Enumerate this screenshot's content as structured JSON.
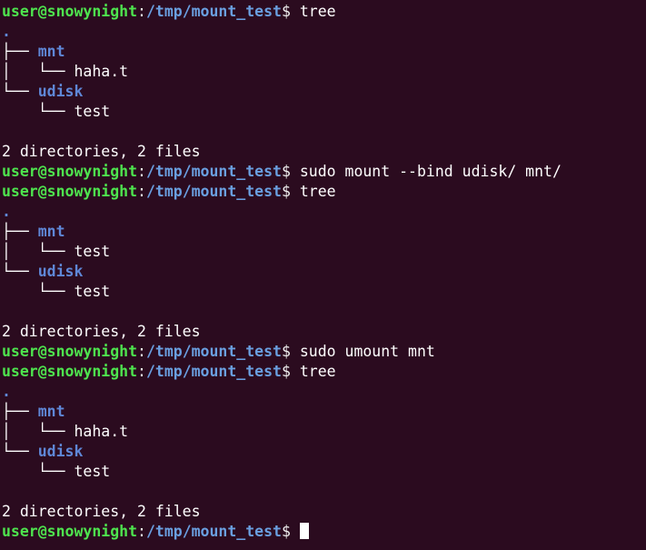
{
  "terminal": {
    "colors": {
      "background": "#2b0b1f",
      "user_green": "#4ee44e",
      "path_blue": "#6a9fe0",
      "dir_blue": "#5f87d7",
      "text_white": "#ffffff"
    },
    "prompt": {
      "user_host": "user@snowynight",
      "separator": ":",
      "path": "/tmp/mount_test",
      "dollar": "$"
    },
    "lines": [
      {
        "type": "prompt",
        "command": "tree"
      },
      {
        "type": "tree_root",
        "text": "."
      },
      {
        "type": "tree_dir",
        "branch": "├── ",
        "name": "mnt"
      },
      {
        "type": "tree_file",
        "branch": "│   └── ",
        "name": "haha.t"
      },
      {
        "type": "tree_dir",
        "branch": "└── ",
        "name": "udisk"
      },
      {
        "type": "tree_file",
        "branch": "    └── ",
        "name": "test"
      },
      {
        "type": "blank"
      },
      {
        "type": "output",
        "text": "2 directories, 2 files"
      },
      {
        "type": "prompt",
        "command": "sudo mount --bind udisk/ mnt/"
      },
      {
        "type": "prompt",
        "command": "tree"
      },
      {
        "type": "tree_root",
        "text": "."
      },
      {
        "type": "tree_dir",
        "branch": "├── ",
        "name": "mnt"
      },
      {
        "type": "tree_file",
        "branch": "│   └── ",
        "name": "test"
      },
      {
        "type": "tree_dir",
        "branch": "└── ",
        "name": "udisk"
      },
      {
        "type": "tree_file",
        "branch": "    └── ",
        "name": "test"
      },
      {
        "type": "blank"
      },
      {
        "type": "output",
        "text": "2 directories, 2 files"
      },
      {
        "type": "prompt",
        "command": "sudo umount mnt"
      },
      {
        "type": "prompt",
        "command": "tree"
      },
      {
        "type": "tree_root",
        "text": "."
      },
      {
        "type": "tree_dir",
        "branch": "├── ",
        "name": "mnt"
      },
      {
        "type": "tree_file",
        "branch": "│   └── ",
        "name": "haha.t"
      },
      {
        "type": "tree_dir",
        "branch": "└── ",
        "name": "udisk"
      },
      {
        "type": "tree_file",
        "branch": "    └── ",
        "name": "test"
      },
      {
        "type": "blank"
      },
      {
        "type": "output",
        "text": "2 directories, 2 files"
      },
      {
        "type": "prompt",
        "command": "",
        "cursor": true
      }
    ]
  }
}
